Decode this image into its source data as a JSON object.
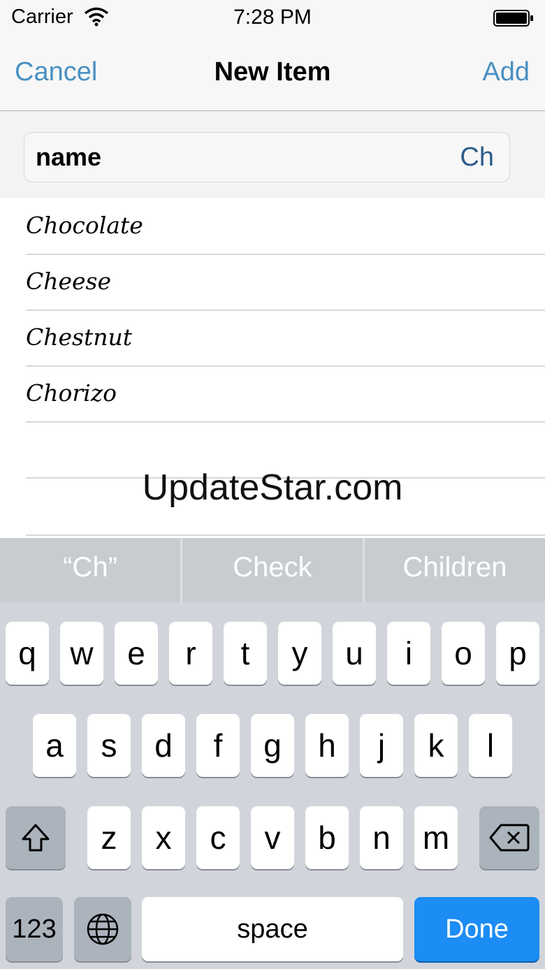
{
  "status_bar": {
    "carrier": "Carrier",
    "time": "7:28 PM"
  },
  "nav": {
    "cancel": "Cancel",
    "title": "New Item",
    "add": "Add"
  },
  "field": {
    "label": "name",
    "value": "Ch"
  },
  "list": [
    "Chocolate",
    "Cheese",
    "Chestnut",
    "Chorizo"
  ],
  "watermark": "UpdateStar.com",
  "suggestions": [
    "“Ch”",
    "Check",
    "Children"
  ],
  "keyboard": {
    "row1": [
      "q",
      "w",
      "e",
      "r",
      "t",
      "y",
      "u",
      "i",
      "o",
      "p"
    ],
    "row2": [
      "a",
      "s",
      "d",
      "f",
      "g",
      "h",
      "j",
      "k",
      "l"
    ],
    "row3": [
      "z",
      "x",
      "c",
      "v",
      "b",
      "n",
      "m"
    ],
    "numbers": "123",
    "space": "space",
    "done": "Done"
  },
  "colors": {
    "link": "#4a90c2",
    "done": "#1c8df5"
  }
}
